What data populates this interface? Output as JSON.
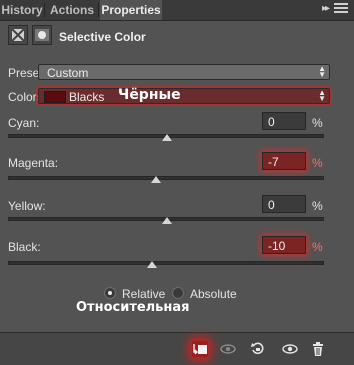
{
  "tabs": [
    {
      "label": "History"
    },
    {
      "label": "Actions"
    },
    {
      "label": "Properties"
    }
  ],
  "panel": {
    "title": "Selective Color"
  },
  "preset": {
    "label": "Preset:",
    "value": "Custom"
  },
  "colors": {
    "label": "Colors:",
    "value": "Blacks",
    "swatch_color": "#5a0c0c",
    "annotation": "Чёрные"
  },
  "sliders": [
    {
      "label": "Cyan:",
      "value": "0",
      "unit": "%",
      "level": 0
    },
    {
      "label": "Magenta:",
      "value": "-7",
      "unit": "%",
      "level": -7
    },
    {
      "label": "Yellow:",
      "value": "0",
      "unit": "%",
      "level": 0
    },
    {
      "label": "Black:",
      "value": "-10",
      "unit": "%",
      "level": -10
    }
  ],
  "method": {
    "relative_label": "Relative",
    "absolute_label": "Absolute",
    "selected": "Relative",
    "annotation": "Относительная"
  },
  "accent": "#d22a2a",
  "bottom_icons": [
    "clip-to-layer-icon",
    "visibility-previous-icon",
    "reset-icon",
    "eye-icon",
    "trash-icon"
  ]
}
